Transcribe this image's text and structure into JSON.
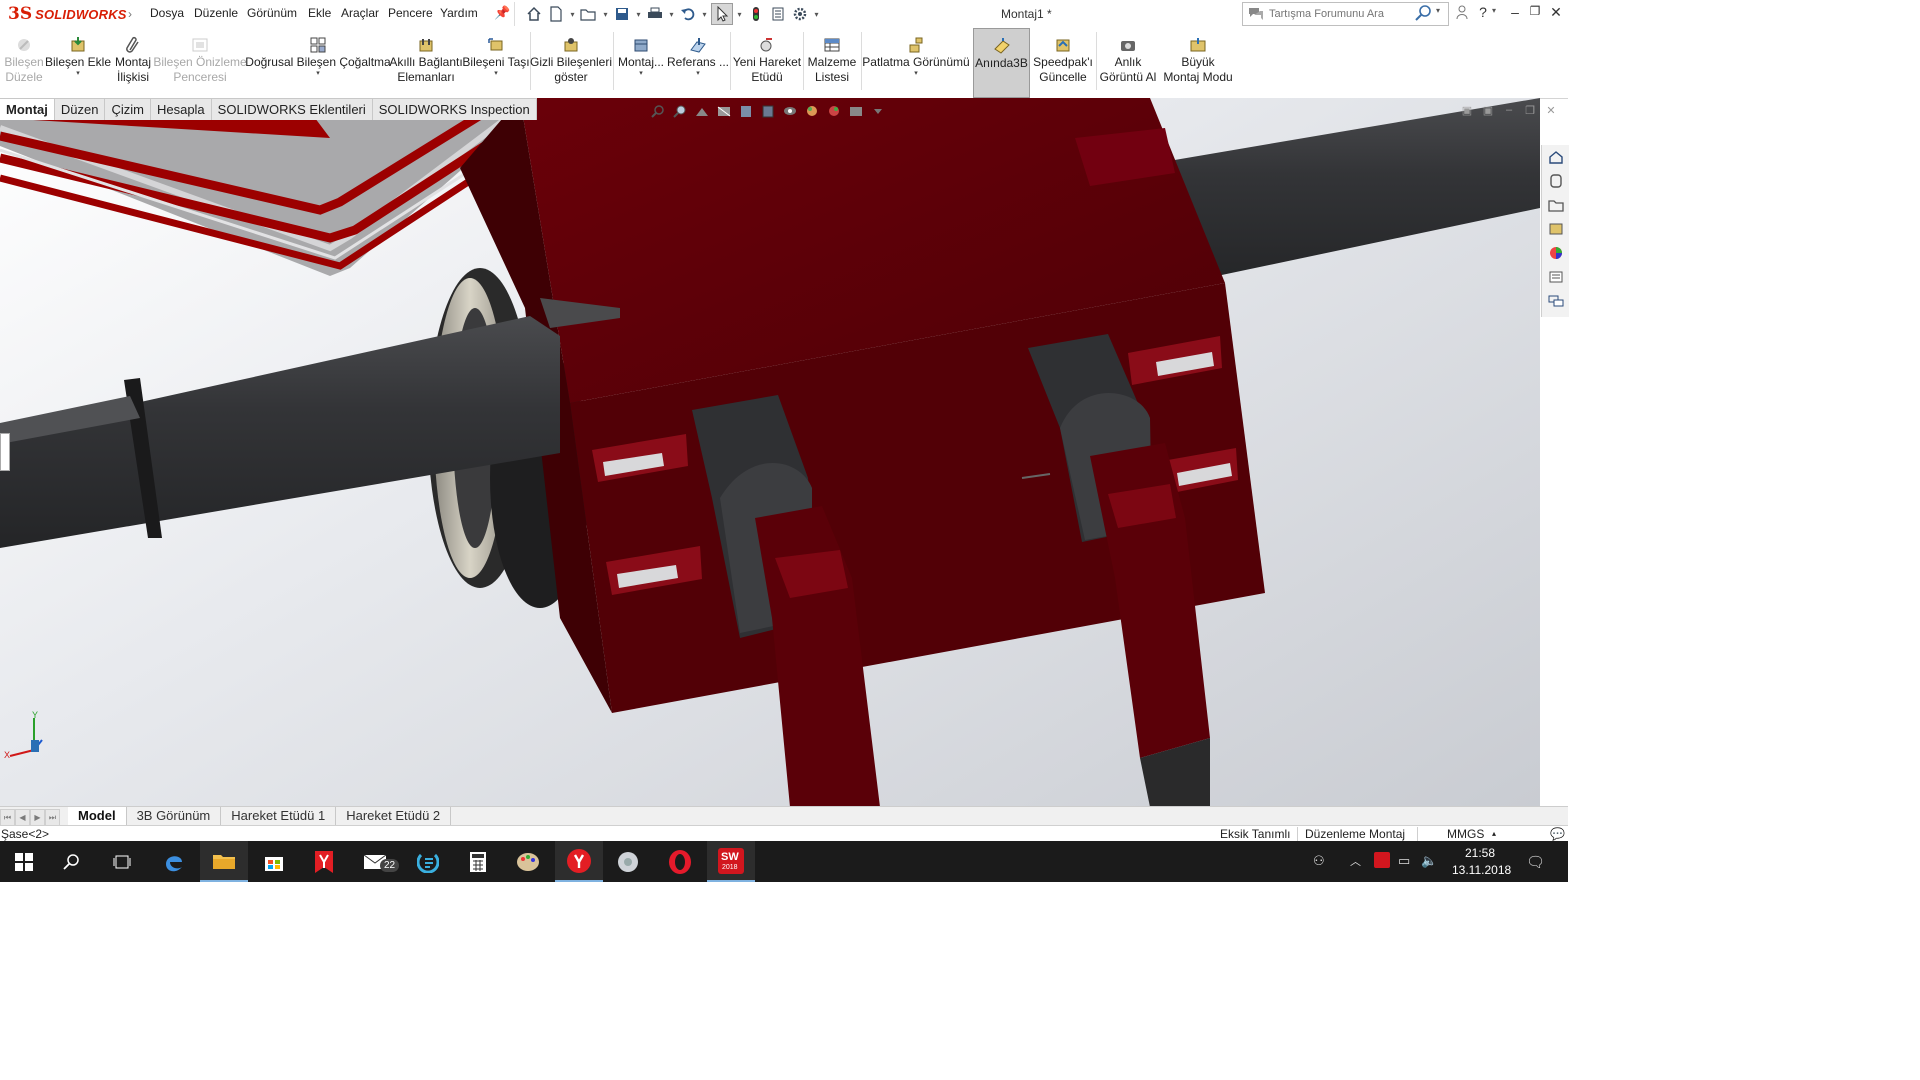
{
  "app": {
    "brand_mark": "3S",
    "brand_name": "SOLIDWORKS",
    "document_title": "Montaj1 *"
  },
  "menu": [
    "Dosya",
    "Düzenle",
    "Görünüm",
    "Ekle",
    "Araçlar",
    "Pencere",
    "Yardım"
  ],
  "quick_access_icons": [
    "home-icon",
    "new-document-icon",
    "open-icon",
    "save-icon",
    "print-icon",
    "undo-icon",
    "select-icon",
    "rebuild-icon",
    "file-properties-icon",
    "options-icon"
  ],
  "search": {
    "placeholder": "Tartışma Forumunu Ara"
  },
  "command_manager": [
    {
      "label": "Bileşen\nDüzele",
      "disabled": true
    },
    {
      "label": "Bileşen Ekle",
      "dropdown": true
    },
    {
      "label": "Montaj\nİlişkisi"
    },
    {
      "label": "Bileşen Önizleme\nPenceresi",
      "disabled": true
    },
    {
      "label": "Doğrusal Bileşen Çoğaltma",
      "dropdown": true
    },
    {
      "label": "Akıllı Bağlantı\nElemanları"
    },
    {
      "label": "Bileşeni Taşı",
      "dropdown": true
    },
    {
      "label": "Gizli Bileşenleri\ngöster"
    },
    {
      "label": "Montaj...",
      "dropdown": true
    },
    {
      "label": "Referans ...",
      "dropdown": true
    },
    {
      "label": "Yeni Hareket\nEtüdü"
    },
    {
      "label": "Malzeme\nListesi"
    },
    {
      "label": "Patlatma Görünümü",
      "dropdown": true
    },
    {
      "label": "Anında3B",
      "active": true
    },
    {
      "label": "Speedpak'ı\nGüncelle"
    },
    {
      "label": "Anlık\nGörüntü Al"
    },
    {
      "label": "Büyük\nMontaj Modu"
    }
  ],
  "tabs": [
    {
      "label": "Montaj",
      "active": true
    },
    {
      "label": "Düzen"
    },
    {
      "label": "Çizim"
    },
    {
      "label": "Hesapla"
    },
    {
      "label": "SOLIDWORKS Eklentileri"
    },
    {
      "label": "SOLIDWORKS Inspection"
    }
  ],
  "heads_up_icons": [
    "zoom-to-fit-icon",
    "zoom-area-icon",
    "previous-view-icon",
    "section-view-icon",
    "dynamic-annotation-icon",
    "view-orientation-icon",
    "display-style-icon",
    "hide-show-icon",
    "edit-appearance-icon",
    "apply-scene-icon",
    "view-settings-icon"
  ],
  "task_pane_icons": [
    "sw-resources-icon",
    "design-library-icon",
    "file-explorer-icon",
    "view-palette-icon",
    "appearances-icon",
    "custom-properties-icon",
    "forum-icon"
  ],
  "triad": {
    "y": "Y",
    "x": "X"
  },
  "bottom_tabs": [
    {
      "label": "Model",
      "active": true
    },
    {
      "label": "3B Görünüm"
    },
    {
      "label": "Hareket Etüdü 1"
    },
    {
      "label": "Hareket Etüdü 2"
    }
  ],
  "status": {
    "selection": "Şase<2>",
    "definition": "Eksik Tanımlı",
    "mode": "Düzenleme Montaj",
    "units": "MMGS"
  },
  "taskbar": {
    "apps": [
      "windows-start-icon",
      "search-icon",
      "task-view-icon",
      "edge-icon",
      "file-explorer-icon",
      "store-icon",
      "yandex-icon",
      "mail-icon",
      "app-icon",
      "calculator-icon",
      "paint-icon",
      "yandex-browser-icon",
      "media-icon",
      "opera-icon",
      "solidworks-icon"
    ],
    "mail_badge": "22",
    "solidworks_label": "SW",
    "solidworks_year": "2018",
    "time": "21:58",
    "date": "13.11.2018"
  },
  "colors": {
    "brand": "#d81e05",
    "part_red": "#5e0008",
    "part_dark": "#2e2f31",
    "taskbar": "#1b1b1b"
  }
}
